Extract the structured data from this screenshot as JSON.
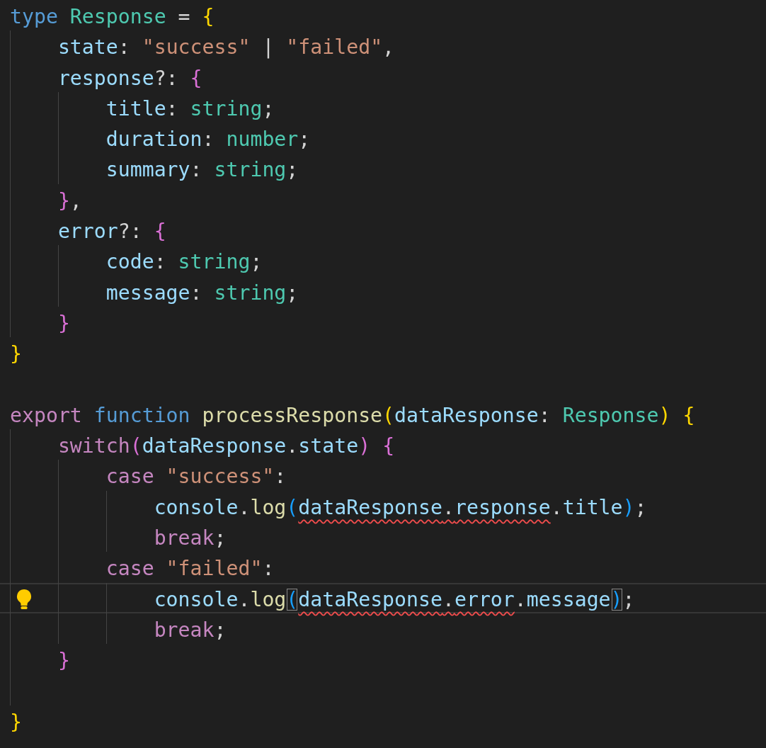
{
  "editor": {
    "lines": [
      {
        "current": false,
        "lightbulb": false,
        "tokens": [
          {
            "kind": "kw",
            "text": "type "
          },
          {
            "kind": "type",
            "text": "Response"
          },
          {
            "kind": "p",
            "text": " = "
          },
          {
            "kind": "b1",
            "text": "{"
          }
        ],
        "children": [
          {
            "current": false,
            "lightbulb": false,
            "tokens": [
              {
                "kind": "prop",
                "text": "state"
              },
              {
                "kind": "p",
                "text": ": "
              },
              {
                "kind": "str",
                "text": "\"success\""
              },
              {
                "kind": "p",
                "text": " | "
              },
              {
                "kind": "str",
                "text": "\"failed\""
              },
              {
                "kind": "p",
                "text": ","
              }
            ]
          },
          {
            "current": false,
            "lightbulb": false,
            "tokens": [
              {
                "kind": "prop",
                "text": "response"
              },
              {
                "kind": "p",
                "text": "?: "
              },
              {
                "kind": "b2",
                "text": "{"
              }
            ],
            "children": [
              {
                "current": false,
                "lightbulb": false,
                "tokens": [
                  {
                    "kind": "prop",
                    "text": "title"
                  },
                  {
                    "kind": "p",
                    "text": ": "
                  },
                  {
                    "kind": "type",
                    "text": "string"
                  },
                  {
                    "kind": "p",
                    "text": ";"
                  }
                ]
              },
              {
                "current": false,
                "lightbulb": false,
                "tokens": [
                  {
                    "kind": "prop",
                    "text": "duration"
                  },
                  {
                    "kind": "p",
                    "text": ": "
                  },
                  {
                    "kind": "type",
                    "text": "number"
                  },
                  {
                    "kind": "p",
                    "text": ";"
                  }
                ]
              },
              {
                "current": false,
                "lightbulb": false,
                "tokens": [
                  {
                    "kind": "prop",
                    "text": "summary"
                  },
                  {
                    "kind": "p",
                    "text": ": "
                  },
                  {
                    "kind": "type",
                    "text": "string"
                  },
                  {
                    "kind": "p",
                    "text": ";"
                  }
                ]
              }
            ]
          },
          {
            "current": false,
            "lightbulb": false,
            "tokens": [
              {
                "kind": "b2",
                "text": "}"
              },
              {
                "kind": "p",
                "text": ","
              }
            ]
          },
          {
            "current": false,
            "lightbulb": false,
            "tokens": [
              {
                "kind": "prop",
                "text": "error"
              },
              {
                "kind": "p",
                "text": "?: "
              },
              {
                "kind": "b2",
                "text": "{"
              }
            ],
            "children": [
              {
                "current": false,
                "lightbulb": false,
                "tokens": [
                  {
                    "kind": "prop",
                    "text": "code"
                  },
                  {
                    "kind": "p",
                    "text": ": "
                  },
                  {
                    "kind": "type",
                    "text": "string"
                  },
                  {
                    "kind": "p",
                    "text": ";"
                  }
                ]
              },
              {
                "current": false,
                "lightbulb": false,
                "tokens": [
                  {
                    "kind": "prop",
                    "text": "message"
                  },
                  {
                    "kind": "p",
                    "text": ": "
                  },
                  {
                    "kind": "type",
                    "text": "string"
                  },
                  {
                    "kind": "p",
                    "text": ";"
                  }
                ]
              }
            ]
          },
          {
            "current": false,
            "lightbulb": false,
            "tokens": [
              {
                "kind": "b2",
                "text": "}"
              }
            ]
          }
        ]
      },
      {
        "current": false,
        "lightbulb": false,
        "tokens": [
          {
            "kind": "b1",
            "text": "}"
          }
        ]
      },
      {
        "current": false,
        "lightbulb": false
      },
      {
        "current": false,
        "lightbulb": false,
        "tokens": [
          {
            "kind": "ctrl",
            "text": "export "
          },
          {
            "kind": "kw",
            "text": "function "
          },
          {
            "kind": "fn",
            "text": "processResponse"
          },
          {
            "kind": "b1",
            "text": "("
          },
          {
            "kind": "prop",
            "text": "dataResponse"
          },
          {
            "kind": "p",
            "text": ": "
          },
          {
            "kind": "type",
            "text": "Response"
          },
          {
            "kind": "b1",
            "text": ")"
          },
          {
            "kind": "b1",
            "text": " {"
          }
        ],
        "children": [
          {
            "current": false,
            "lightbulb": false,
            "tokens": [
              {
                "kind": "ctrl",
                "text": "switch"
              },
              {
                "kind": "b2",
                "text": "("
              },
              {
                "kind": "prop",
                "text": "dataResponse"
              },
              {
                "kind": "p",
                "text": "."
              },
              {
                "kind": "prop",
                "text": "state"
              },
              {
                "kind": "b2",
                "text": ")"
              },
              {
                "kind": "b2",
                "text": " {"
              }
            ],
            "children": [
              {
                "current": false,
                "lightbulb": false,
                "tokens": [
                  {
                    "kind": "ctrl",
                    "text": "case "
                  },
                  {
                    "kind": "str",
                    "text": "\"success\""
                  },
                  {
                    "kind": "p",
                    "text": ":"
                  }
                ],
                "children": [
                  {
                    "current": false,
                    "lightbulb": false,
                    "tokens": [
                      {
                        "kind": "prop",
                        "text": "console"
                      },
                      {
                        "kind": "p",
                        "text": "."
                      },
                      {
                        "kind": "fn",
                        "text": "log"
                      },
                      {
                        "kind": "b3",
                        "text": "("
                      },
                      {
                        "kind": "prop",
                        "text": "dataResponse",
                        "squiggle": true
                      },
                      {
                        "kind": "p",
                        "text": ".",
                        "squiggle": true
                      },
                      {
                        "kind": "prop",
                        "text": "response",
                        "squiggle": true
                      },
                      {
                        "kind": "p",
                        "text": "."
                      },
                      {
                        "kind": "prop",
                        "text": "title"
                      },
                      {
                        "kind": "b3",
                        "text": ")"
                      },
                      {
                        "kind": "p",
                        "text": ";"
                      }
                    ]
                  },
                  {
                    "current": false,
                    "lightbulb": false,
                    "tokens": [
                      {
                        "kind": "ctrl",
                        "text": "break"
                      },
                      {
                        "kind": "p",
                        "text": ";"
                      }
                    ]
                  }
                ]
              },
              {
                "current": false,
                "lightbulb": false,
                "tokens": [
                  {
                    "kind": "ctrl",
                    "text": "case "
                  },
                  {
                    "kind": "str",
                    "text": "\"failed\""
                  },
                  {
                    "kind": "p",
                    "text": ":"
                  }
                ],
                "children": [
                  {
                    "current": true,
                    "lightbulb": true,
                    "tokens": [
                      {
                        "kind": "prop",
                        "text": "console"
                      },
                      {
                        "kind": "p",
                        "text": "."
                      },
                      {
                        "kind": "fn",
                        "text": "log"
                      },
                      {
                        "kind": "b3",
                        "text": "(",
                        "matched": true
                      },
                      {
                        "kind": "prop",
                        "text": "dataResponse",
                        "squiggle": true
                      },
                      {
                        "kind": "p",
                        "text": ".",
                        "squiggle": true
                      },
                      {
                        "kind": "prop",
                        "text": "error",
                        "squiggle": true
                      },
                      {
                        "kind": "p",
                        "text": "."
                      },
                      {
                        "kind": "prop",
                        "text": "message"
                      },
                      {
                        "kind": "b3",
                        "text": ")",
                        "matched": true
                      },
                      {
                        "kind": "p",
                        "text": ";"
                      }
                    ]
                  },
                  {
                    "current": false,
                    "lightbulb": false,
                    "tokens": [
                      {
                        "kind": "ctrl",
                        "text": "break"
                      },
                      {
                        "kind": "p",
                        "text": ";"
                      }
                    ]
                  }
                ]
              }
            ]
          },
          {
            "current": false,
            "lightbulb": false,
            "tokens": [
              {
                "kind": "b2",
                "text": "}"
              }
            ]
          },
          {
            "current": false,
            "lightbulb": false
          }
        ]
      },
      {
        "current": false,
        "lightbulb": false,
        "tokens": [
          {
            "kind": "b1",
            "text": "}"
          }
        ]
      }
    ]
  }
}
